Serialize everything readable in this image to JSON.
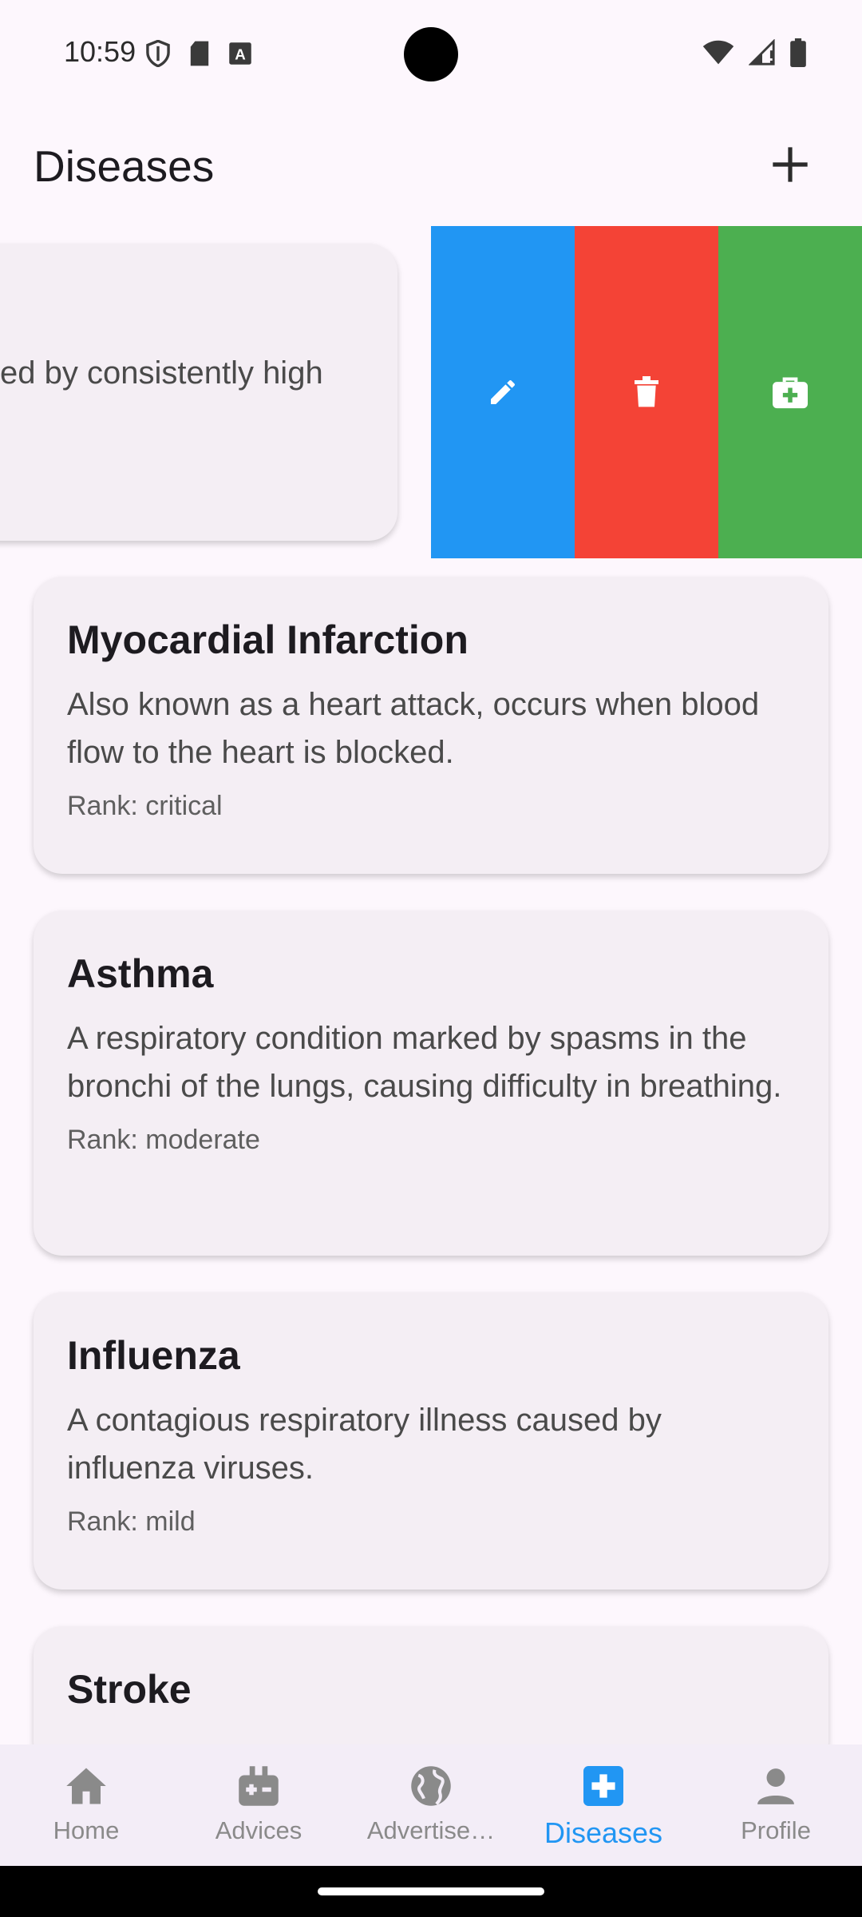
{
  "status_bar": {
    "time": "10:59",
    "left_icons": [
      "shield-icon",
      "sd-card-icon",
      "keyboard-a-icon"
    ],
    "right_icons": [
      "wifi-icon",
      "signal-icon",
      "battery-icon"
    ]
  },
  "app_bar": {
    "title": "Diseases",
    "add_icon": "plus-icon"
  },
  "swiped_card": {
    "description_fragment": "ed by consistently high"
  },
  "swipe_actions": [
    {
      "name": "edit",
      "icon": "pencil-icon",
      "color": "#2196F3"
    },
    {
      "name": "delete",
      "icon": "trash-icon",
      "color": "#F44336"
    },
    {
      "name": "treatment",
      "icon": "medical-bag-icon",
      "color": "#4CAF50"
    }
  ],
  "diseases": [
    {
      "title": "Myocardial Infarction",
      "description": "Also known as a heart attack, occurs when blood flow to the heart is blocked.",
      "rank": "Rank: critical"
    },
    {
      "title": "Asthma",
      "description": "A respiratory condition marked by spasms in the bronchi of the lungs, causing difficulty in breathing.",
      "rank": "Rank: moderate"
    },
    {
      "title": "Influenza",
      "description": "A contagious respiratory illness caused by influenza viruses.",
      "rank": "Rank: mild"
    },
    {
      "title": "Stroke"
    }
  ],
  "bottom_nav": {
    "items": [
      {
        "label": "Home",
        "icon": "home-icon"
      },
      {
        "label": "Advices",
        "icon": "medical-kit-icon"
      },
      {
        "label": "Advertise…",
        "icon": "globe-icon"
      },
      {
        "label": "Diseases",
        "icon": "medical-cross-icon",
        "active": true
      },
      {
        "label": "Profile",
        "icon": "person-icon"
      }
    ],
    "active_color": "#2196F3",
    "inactive_color": "#8a8a8a"
  }
}
